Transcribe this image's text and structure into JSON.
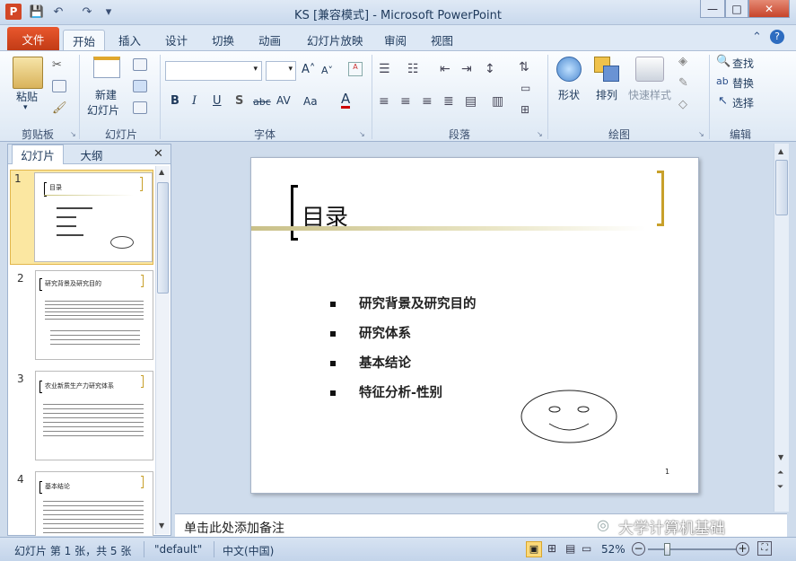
{
  "window": {
    "title": "KS [兼容模式] - Microsoft PowerPoint",
    "min": "—",
    "max": "□",
    "close": "✕"
  },
  "quick_access": {
    "save": "💾",
    "undo": "↶",
    "redo": "↷",
    "customize": "▾"
  },
  "tabs": [
    "文件",
    "开始",
    "插入",
    "设计",
    "切换",
    "动画",
    "幻灯片放映",
    "审阅",
    "视图"
  ],
  "ribbon": {
    "clipboard": {
      "label": "剪贴板",
      "paste": "粘贴"
    },
    "slides": {
      "label": "幻灯片",
      "new_slide_1": "新建",
      "new_slide_2": "幻灯片"
    },
    "font": {
      "label": "字体",
      "bold": "B",
      "italic": "I",
      "underline": "U",
      "shadow": "S",
      "strike": "abc",
      "spacing": "AV",
      "case": "Aa",
      "color": "A",
      "grow": "A˄",
      "shrink": "A˅"
    },
    "paragraph": {
      "label": "段落"
    },
    "drawing": {
      "label": "绘图",
      "shapes": "形状",
      "arrange": "排列",
      "quick_styles": "快速样式"
    },
    "editing": {
      "label": "编辑",
      "find": "查找",
      "replace": "替换",
      "select": "选择"
    }
  },
  "left_pane": {
    "tab_slides": "幻灯片",
    "tab_outline": "大纲",
    "close": "✕"
  },
  "thumbnails": [
    {
      "num": "1",
      "title": "目录"
    },
    {
      "num": "2",
      "title": "研究背景及研究目的"
    },
    {
      "num": "3",
      "title": "农业新质生产力研究体系"
    },
    {
      "num": "4",
      "title": "基本结论"
    }
  ],
  "slide": {
    "title": "目录",
    "bullets": [
      "研究背景及研究目的",
      "研究体系",
      "基本结论",
      "特征分析-性别"
    ],
    "page_number": "1"
  },
  "notes": {
    "placeholder": "单击此处添加备注"
  },
  "watermark": {
    "text": "大学计算机基础"
  },
  "status": {
    "slide_info": "幻灯片 第 1 张，共 5 张",
    "theme": "\"default\"",
    "language": "中文(中国)",
    "zoom": "52%"
  },
  "colors": {
    "file_tab": "#d24726",
    "accent_gold": "#c8a02a",
    "ribbon_bg": "#dde8f4"
  }
}
